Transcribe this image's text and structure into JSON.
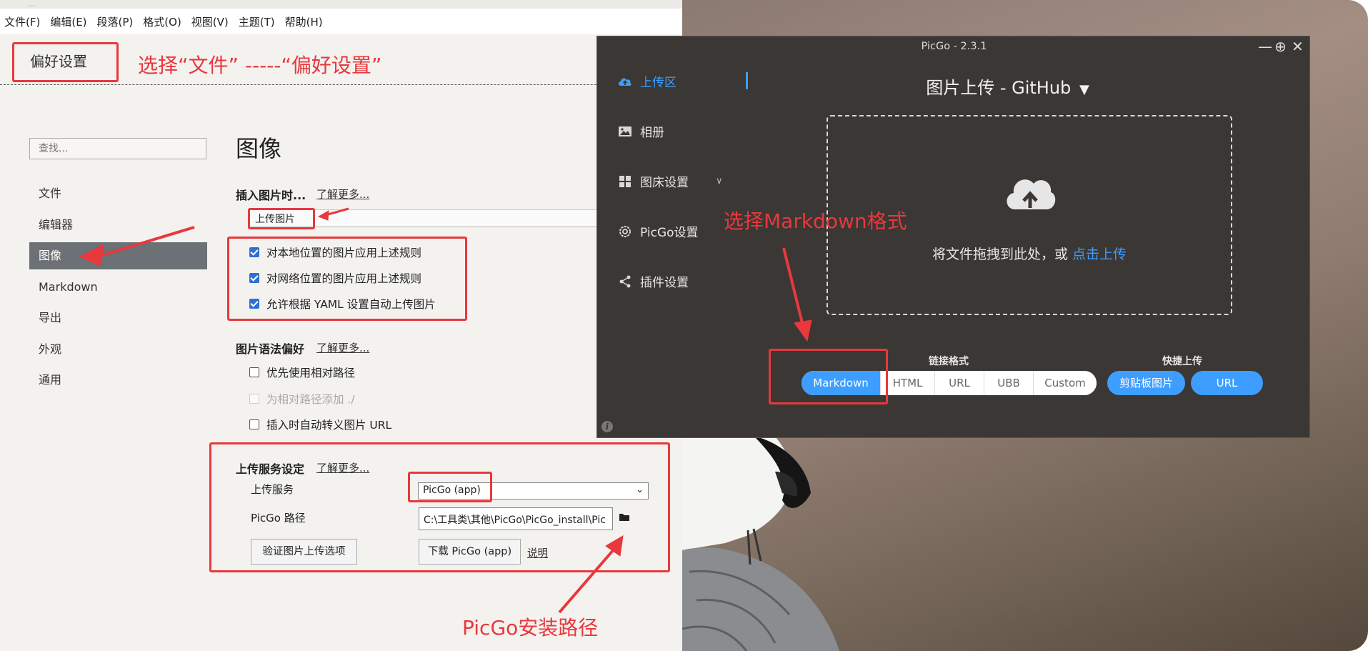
{
  "typora": {
    "titlebar": "...",
    "menu": [
      "文件(F)",
      "编辑(E)",
      "段落(P)",
      "格式(O)",
      "视图(V)",
      "主题(T)",
      "帮助(H)"
    ],
    "pref_title": "偏好设置",
    "search_placeholder": "查找...",
    "nav": [
      "文件",
      "编辑器",
      "图像",
      "Markdown",
      "导出",
      "外观",
      "通用"
    ],
    "active_nav": "图像",
    "section_title": "图像",
    "insert_heading": "插入图片时...",
    "learn_more": "了解更多...",
    "insert_value": "上传图片",
    "insert_checks": [
      {
        "label": "对本地位置的图片应用上述规则",
        "checked": true
      },
      {
        "label": "对网络位置的图片应用上述规则",
        "checked": true
      },
      {
        "label": "允许根据 YAML 设置自动上传图片",
        "checked": true
      }
    ],
    "syntax_heading": "图片语法偏好",
    "syntax_checks": [
      {
        "label": "优先使用相对路径",
        "checked": false
      },
      {
        "label": "为相对路径添加 ./",
        "checked": false,
        "disabled": true
      },
      {
        "label": "插入时自动转义图片 URL",
        "checked": false
      }
    ],
    "upload_heading": "上传服务设定",
    "upload_service_label": "上传服务",
    "upload_service_value": "PicGo (app)",
    "picgo_path_label": "PicGo 路径",
    "picgo_path_value": "C:\\工具类\\其他\\PicGo\\PicGo_install\\Pic",
    "verify_button": "验证图片上传选项",
    "download_button": "下载 PicGo (app)",
    "explain_link": "说明"
  },
  "picgo": {
    "title": "PicGo - 2.3.1",
    "nav": [
      {
        "label": "上传区",
        "icon": "cloud-upload-icon",
        "active": true
      },
      {
        "label": "相册",
        "icon": "image-icon"
      },
      {
        "label": "图床设置",
        "icon": "grid-icon"
      },
      {
        "label": "PicGo设置",
        "icon": "gear-icon"
      },
      {
        "label": "插件设置",
        "icon": "share-icon"
      }
    ],
    "upload_title": "图片上传 - GitHub",
    "drop_text": "将文件拖拽到此处，或 ",
    "drop_link": "点击上传",
    "link_format_label": "链接格式",
    "formats": [
      "Markdown",
      "HTML",
      "URL",
      "UBB",
      "Custom"
    ],
    "active_format": "Markdown",
    "quick_upload_label": "快捷上传",
    "quick_buttons": [
      "剪贴板图片",
      "URL"
    ],
    "accent": "#3d9eff"
  },
  "annotations": {
    "step1": "选择“文件” -----“偏好设置”",
    "step2": "选择Markdown格式",
    "step3": "PicGo安装路径",
    "color": "#e8383d"
  }
}
